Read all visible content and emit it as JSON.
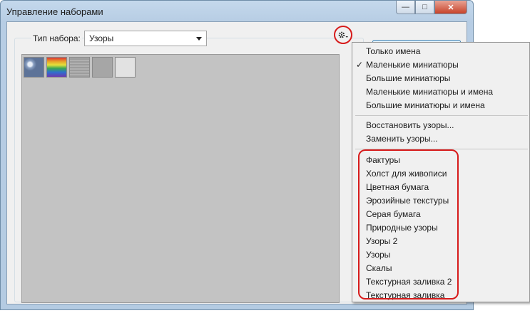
{
  "window": {
    "title": "Управление наборами",
    "minimize_icon": "minimize-icon",
    "maximize_icon": "maximize-icon",
    "close_icon": "close-icon"
  },
  "preset": {
    "label": "Тип набора:",
    "selected": "Узоры"
  },
  "gear_icon": "gear-icon",
  "thumbnails": [
    {
      "name": "bubbles-pattern",
      "color": "#7d93b8"
    },
    {
      "name": "rainbow-pattern",
      "color": "#c8a04a"
    },
    {
      "name": "gray-texture-pattern",
      "color": "#9a9a9a"
    },
    {
      "name": "gray-pattern",
      "color": "#a4a4a4"
    },
    {
      "name": "light-pattern",
      "color": "#dedede"
    }
  ],
  "menu": {
    "view_items": [
      {
        "label": "Только имена",
        "checked": false
      },
      {
        "label": "Маленькие миниатюры",
        "checked": true
      },
      {
        "label": "Большие миниатюры",
        "checked": false
      },
      {
        "label": "Маленькие миниатюры и имена",
        "checked": false
      },
      {
        "label": "Большие миниатюры и имена",
        "checked": false
      }
    ],
    "action_items": [
      {
        "label": "Восстановить узоры..."
      },
      {
        "label": "Заменить узоры..."
      }
    ],
    "library_items": [
      {
        "label": "Фактуры"
      },
      {
        "label": "Холст для живописи"
      },
      {
        "label": "Цветная бумага"
      },
      {
        "label": "Эрозийные текстуры"
      },
      {
        "label": "Серая бумага"
      },
      {
        "label": "Природные узоры"
      },
      {
        "label": "Узоры 2"
      },
      {
        "label": "Узоры"
      },
      {
        "label": "Скалы"
      },
      {
        "label": "Текстурная заливка 2"
      },
      {
        "label": "Текстурная заливка"
      }
    ]
  },
  "check_mark": "✓"
}
